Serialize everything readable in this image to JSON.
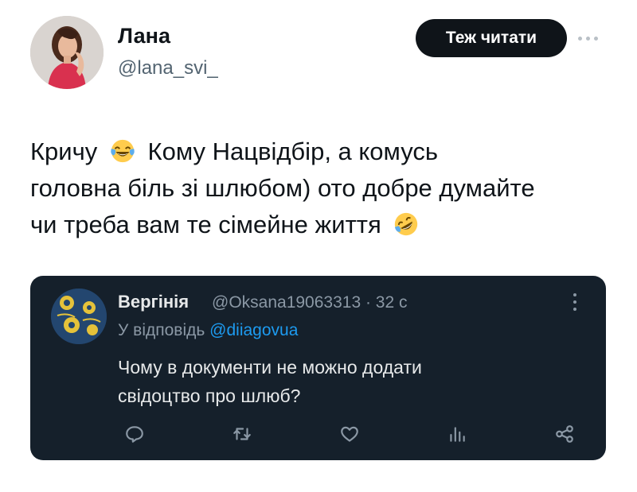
{
  "author": {
    "name": "Лана",
    "handle": "@lana_svi_"
  },
  "follow_button": {
    "label": "Теж читати"
  },
  "tweet": {
    "line1_before": "Кричу",
    "line1_after": "Кому Нацвідбір,  а комусь",
    "line2": "головна біль зі шлюбом) ото добре думайте",
    "line3": "чи треба вам те сімейне життя",
    "emoji1": "face-with-tears-of-joy-icon",
    "emoji2": "rolling-on-floor-laughing-icon"
  },
  "quoted": {
    "name": "Вергінія",
    "meta": "@Oksana19063313 · 32 с",
    "reply_prefix": "У відповідь",
    "reply_mention": "@diiagovua",
    "text_line1": "Чому в документи не можно додати",
    "text_line2": "свідоцтво про шлюб?",
    "actions": [
      "reply-icon",
      "retweet-icon",
      "like-icon",
      "views-icon",
      "share-icon"
    ]
  },
  "colors": {
    "card_bg": "#15202b",
    "link": "#1d9bf0",
    "button_bg": "#0f1419"
  }
}
